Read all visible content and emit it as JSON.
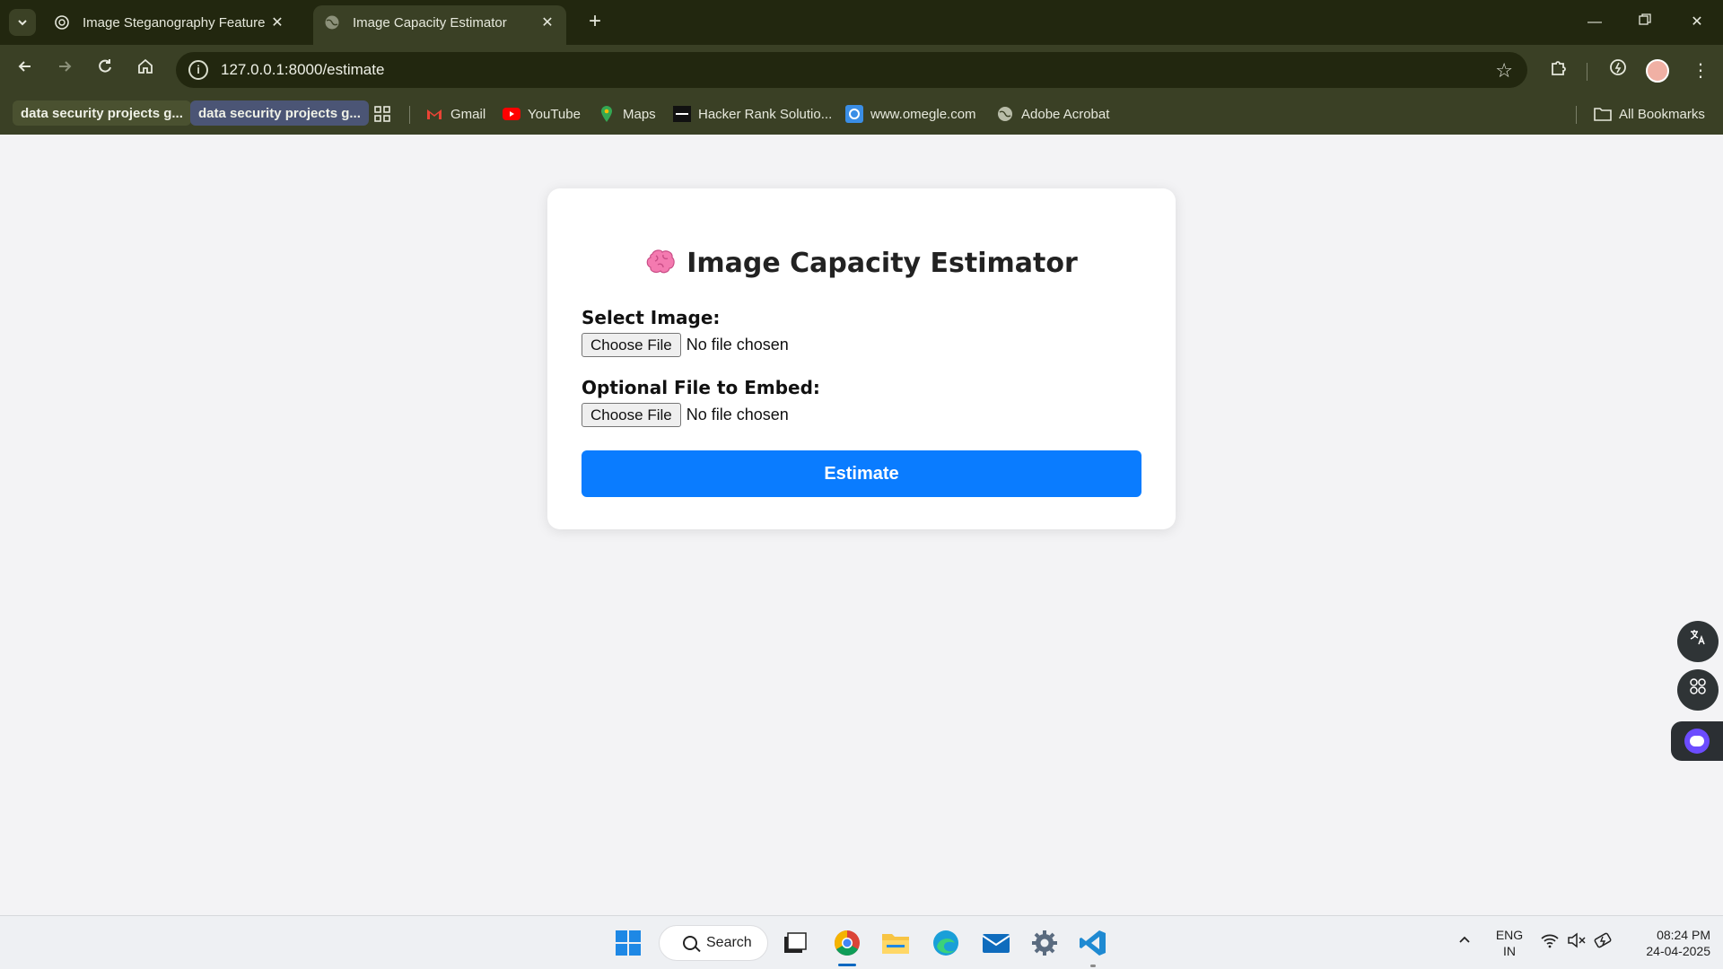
{
  "browser": {
    "tabs": [
      {
        "title": "Image Steganography Feature I",
        "active": false
      },
      {
        "title": "Image Capacity Estimator",
        "active": true
      }
    ],
    "url": "127.0.0.1:8000/estimate",
    "bookmarks": [
      {
        "label": "data security projects g...",
        "type": "chip"
      },
      {
        "label": "data security projects g...",
        "type": "chip"
      },
      {
        "label": "Gmail",
        "icon": "gmail-icon"
      },
      {
        "label": "YouTube",
        "icon": "youtube-icon"
      },
      {
        "label": "Maps",
        "icon": "maps-icon"
      },
      {
        "label": "Hacker Rank Solutio...",
        "icon": "hackerrank-icon"
      },
      {
        "label": "www.omegle.com",
        "icon": "omegle-icon"
      },
      {
        "label": "Adobe Acrobat",
        "icon": "globe-icon"
      }
    ],
    "all_bookmarks": "All Bookmarks"
  },
  "page": {
    "title": "Image Capacity Estimator",
    "title_icon": "brain-icon",
    "select_image_label": "Select Image:",
    "embed_file_label": "Optional File to Embed:",
    "choose_file": "Choose File",
    "no_file": "No file chosen",
    "estimate_button": "Estimate",
    "accent_color": "#0a7cff"
  },
  "taskbar": {
    "search": "Search",
    "language": {
      "line1": "ENG",
      "line2": "IN"
    },
    "time": "08:24 PM",
    "date": "24-04-2025"
  }
}
